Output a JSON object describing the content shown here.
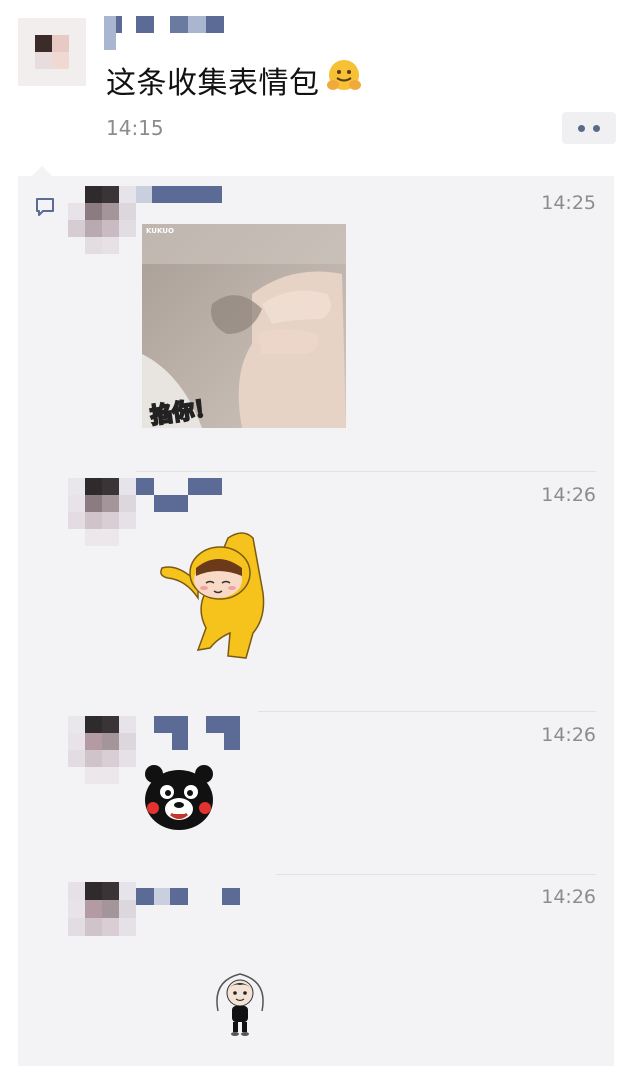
{
  "post": {
    "text": "这条收集表情包",
    "time": "14:15",
    "emoji": "hugging-face-emoji"
  },
  "comments": [
    {
      "time": "14:25",
      "sticker": "pinch-hand-sticker",
      "caption": "掐你！",
      "watermark": "KUKUO"
    },
    {
      "time": "14:26",
      "sticker": "yellow-costume-dancing-sticker"
    },
    {
      "time": "14:26",
      "sticker": "kumamon-bear-sticker"
    },
    {
      "time": "14:26",
      "sticker": "baby-skipping-rope-sticker"
    }
  ],
  "colors": {
    "comment_bg": "#f3f2f5",
    "time_text": "#8c8c8c",
    "name_mosaic": "#5b6b96"
  }
}
